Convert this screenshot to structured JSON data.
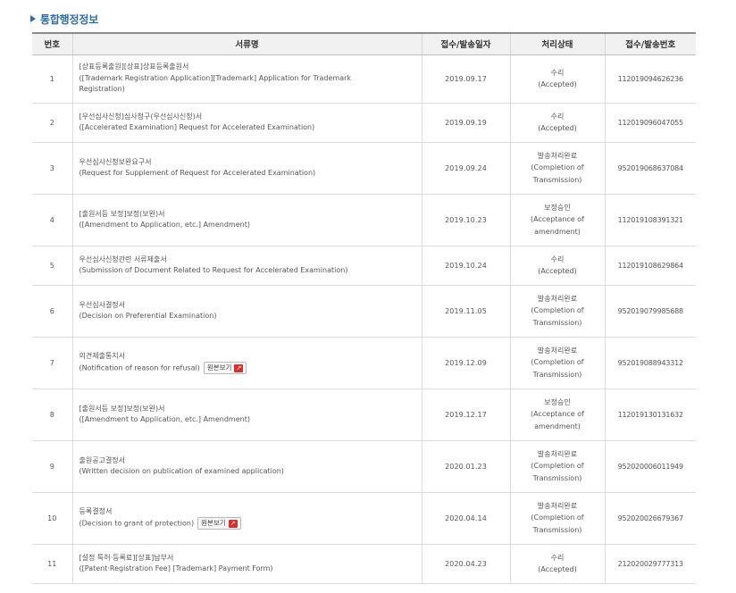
{
  "section": {
    "title": "통합행정정보"
  },
  "table": {
    "headers": {
      "no": "번호",
      "doc": "서류명",
      "date": "접수/발송일자",
      "status": "처리상태",
      "recno": "접수/발송번호"
    },
    "view_label": "원본보기",
    "rows": [
      {
        "no": "1",
        "doc": [
          "[상표등록출원][상표]상표등록출원서",
          "([Trademark Registration Application][Trademark] Application for Trademark",
          "Registration)"
        ],
        "date": "2019.09.17",
        "status": [
          "수리",
          "(Accepted)"
        ],
        "recno": "112019094626236",
        "view": false
      },
      {
        "no": "2",
        "doc": [
          "[우선심사신청]심사청구(우선심사신청)서",
          "([Accelerated Examination] Request for Accelerated Examination)"
        ],
        "date": "2019.09.19",
        "status": [
          "수리",
          "(Accepted)"
        ],
        "recno": "112019096047055",
        "view": false
      },
      {
        "no": "3",
        "doc": [
          "우선심사신청보완요구서",
          "(Request for Supplement of Request for Accelerated Examination)"
        ],
        "date": "2019.09.24",
        "status": [
          "발송처리완료",
          "(Completion of",
          "Transmission)"
        ],
        "recno": "952019068637084",
        "view": false
      },
      {
        "no": "4",
        "doc": [
          "[출원서등 보정]보정(보완)서",
          "([Amendment to Application, etc.] Amendment)"
        ],
        "date": "2019.10.23",
        "status": [
          "보정승인",
          "(Acceptance of",
          "amendment)"
        ],
        "recno": "112019108391321",
        "view": false
      },
      {
        "no": "5",
        "doc": [
          "우선심사신청관련 서류제출서",
          "(Submission of Document Related to Request for Accelerated Examination)"
        ],
        "date": "2019.10.24",
        "status": [
          "수리",
          "(Accepted)"
        ],
        "recno": "112019108629864",
        "view": false
      },
      {
        "no": "6",
        "doc": [
          "우선심사결정서",
          "(Decision on Preferential Examination)"
        ],
        "date": "2019.11.05",
        "status": [
          "발송처리완료",
          "(Completion of",
          "Transmission)"
        ],
        "recno": "952019079985688",
        "view": false
      },
      {
        "no": "7",
        "doc": [
          "의견제출통지서",
          "(Notification of reason for refusal)"
        ],
        "date": "2019.12.09",
        "status": [
          "발송처리완료",
          "(Completion of",
          "Transmission)"
        ],
        "recno": "952019088943312",
        "view": true
      },
      {
        "no": "8",
        "doc": [
          "[출원서등 보정]보정(보완)서",
          "([Amendment to Application, etc.] Amendment)"
        ],
        "date": "2019.12.17",
        "status": [
          "보정승인",
          "(Acceptance of",
          "amendment)"
        ],
        "recno": "112019130131632",
        "view": false
      },
      {
        "no": "9",
        "doc": [
          "출원공고결정서",
          "(Written decision on publication of examined application)"
        ],
        "date": "2020.01.23",
        "status": [
          "발송처리완료",
          "(Completion of",
          "Transmission)"
        ],
        "recno": "952020006011949",
        "view": false
      },
      {
        "no": "10",
        "doc": [
          "등록결정서",
          "(Decision to grant of protection)"
        ],
        "date": "2020.04.14",
        "status": [
          "발송처리완료",
          "(Completion of",
          "Transmission)"
        ],
        "recno": "952020026679367",
        "view": true
      },
      {
        "no": "11",
        "doc": [
          "[설정 특허·등록료][상표]납부서",
          "([Patent·Registration Fee] [Trademark] Payment Form)"
        ],
        "date": "2020.04.23",
        "status": [
          "수리",
          "(Accepted)"
        ],
        "recno": "212020029777313",
        "view": false
      }
    ]
  },
  "icons": {
    "section_marker": "triangle-bullet-icon",
    "pdf": "pdf-icon"
  },
  "colors": {
    "title": "#2e6da4",
    "pdf": "#d9302c"
  }
}
